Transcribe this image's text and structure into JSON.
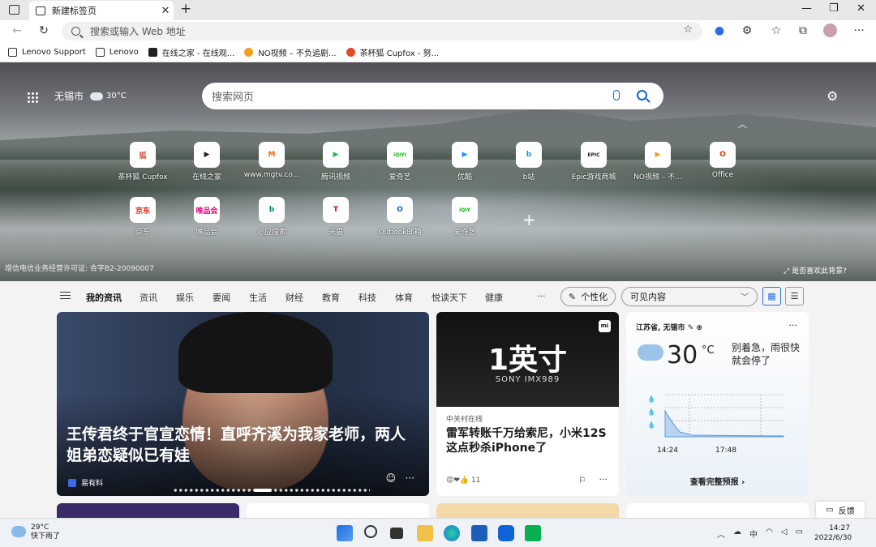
{
  "tabs": [
    {
      "title": "新建标签页",
      "close": "✕"
    }
  ],
  "new_tab": "+",
  "window_controls": {
    "min": "—",
    "max": "❐",
    "close": "✕"
  },
  "address_bar": {
    "placeholder": "搜索或输入 Web 地址"
  },
  "nav": {
    "back": "←",
    "refresh": "↻",
    "more": "···"
  },
  "favorites": [
    {
      "label": "Lenovo Support",
      "color": "#333333"
    },
    {
      "label": "Lenovo",
      "color": "#333333"
    },
    {
      "label": "在线之家 - 在线观...",
      "color": "#222222"
    },
    {
      "label": "NO视频 – 不负追剧...",
      "color": "#f0a020"
    },
    {
      "label": "茶杯狐 Cupfox - 努...",
      "color": "#e04a2a"
    }
  ],
  "hero": {
    "city": "无锡市",
    "temp": "30°C",
    "search_placeholder": "搜索网页",
    "license": "增信电信业务经营许可证: 合字B2-20090007",
    "like_bg": "是否喜欢此背景?",
    "add": "+"
  },
  "quick_links": [
    {
      "label": "茶杯狐 Cupfox",
      "glyph": "狐",
      "color": "#e04a2a"
    },
    {
      "label": "在线之家",
      "glyph": "▶",
      "color": "#222222"
    },
    {
      "label": "www.mgtv.co...",
      "glyph": "M",
      "color": "#ff6a00"
    },
    {
      "label": "腾讯视频",
      "glyph": "▶",
      "color": "#1fb954"
    },
    {
      "label": "爱奇艺",
      "glyph": "iQIYI",
      "color": "#00be06"
    },
    {
      "label": "优酷",
      "glyph": "▶",
      "color": "#1e90ff"
    },
    {
      "label": "b站",
      "glyph": "b",
      "color": "#00a1d6"
    },
    {
      "label": "Epic游戏商城",
      "glyph": "EPIC",
      "color": "#222222"
    },
    {
      "label": "NO视频 – 不...",
      "glyph": "▶",
      "color": "#f0a020"
    },
    {
      "label": "Office",
      "glyph": "O",
      "color": "#d83b01"
    },
    {
      "label": "京东",
      "glyph": "京东",
      "color": "#e1251b"
    },
    {
      "label": "唯品会",
      "glyph": "唯品会",
      "color": "#e5007f"
    },
    {
      "label": "必应搜索",
      "glyph": "b",
      "color": "#008373"
    },
    {
      "label": "天猫",
      "glyph": "T",
      "color": "#d00a1c"
    },
    {
      "label": "Outlook邮箱",
      "glyph": "O",
      "color": "#0a64c8"
    },
    {
      "label": "爱奇艺",
      "glyph": "iQIY",
      "color": "#00be06"
    }
  ],
  "feed_categories": [
    "我的资讯",
    "资讯",
    "娱乐",
    "要闻",
    "生活",
    "财经",
    "教育",
    "科技",
    "体育",
    "悦读天下",
    "健康"
  ],
  "feed_more": "···",
  "personalize": "个性化",
  "visible_content": "可见内容",
  "cards": {
    "main": {
      "headline": "王传君终于官宣恋情！直呼齐溪为我家老师，两人姐弟恋疑似已有娃",
      "source": "易有料"
    },
    "sony": {
      "big": "1英寸",
      "sub": "SONY  IMX989",
      "source": "中关村在线",
      "headline": "雷军转账千万给索尼，小米12S这点秒杀iPhone了",
      "reactions": "11"
    },
    "weather": {
      "location": "江苏省, 无锡市",
      "temp": "30",
      "unit": "°C",
      "status": "别着急，雨很快就会停了",
      "t1": "14:24",
      "t2": "17:48",
      "full": "查看完整预报 ›"
    }
  },
  "feedback": "反馈",
  "taskbar": {
    "temp": "29°C",
    "desc": "快下雨了",
    "ime": "中",
    "time": "14:27",
    "date": "2022/6/30"
  }
}
